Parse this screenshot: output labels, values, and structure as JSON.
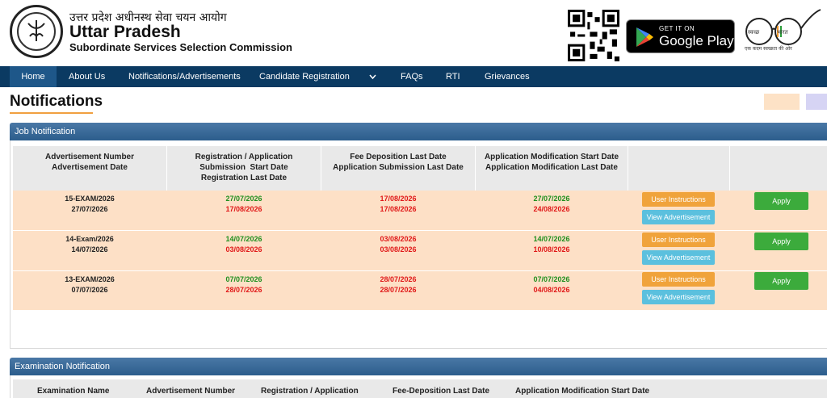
{
  "header": {
    "org_hindi": "उत्तर प्रदेश अधीनस्थ सेवा चयन आयोग",
    "org_title": "Uttar Pradesh",
    "org_subtitle": "Subordinate Services Selection Commission",
    "play_small": "GET IT ON",
    "play_big": "Google Play",
    "swachh_left": "स्वच्छ",
    "swachh_right": "भारत",
    "swachh_tagline": "एक कदम स्वच्छता की ओर"
  },
  "nav": {
    "items": [
      "Home",
      "About Us",
      "Notifications/Advertisements",
      "Candidate Registration",
      "FAQs",
      "RTI",
      "Grievances"
    ],
    "active": "Home",
    "chevron": "chevron-down-icon"
  },
  "page": {
    "title": "Notifications"
  },
  "job_panel": {
    "heading": "Job Notification",
    "columns": [
      [
        "Advertisement Number",
        "Advertisement Date"
      ],
      [
        "Registration / Application",
        "Submission  Start Date",
        "Registration Last Date"
      ],
      [
        "Fee Deposition Last Date",
        "Application Submission Last Date"
      ],
      [
        "Application Modification Start Date",
        "Application Modification Last Date"
      ]
    ],
    "rows": [
      {
        "adv_no": "15-EXAM/2026",
        "adv_date": "27/07/2026",
        "reg_start": "27/07/2026",
        "reg_last": "17/08/2026",
        "fee_last": "17/08/2026",
        "sub_last": "17/08/2026",
        "mod_start": "27/07/2026",
        "mod_last": "24/08/2026"
      },
      {
        "adv_no": "14-Exam/2026",
        "adv_date": "14/07/2026",
        "reg_start": "14/07/2026",
        "reg_last": "03/08/2026",
        "fee_last": "03/08/2026",
        "sub_last": "03/08/2026",
        "mod_start": "14/07/2026",
        "mod_last": "10/08/2026"
      },
      {
        "adv_no": "13-EXAM/2026",
        "adv_date": "07/07/2026",
        "reg_start": "07/07/2026",
        "reg_last": "28/07/2026",
        "fee_last": "28/07/2026",
        "sub_last": "28/07/2026",
        "mod_start": "07/07/2026",
        "mod_last": "04/08/2026"
      }
    ],
    "buttons": {
      "user_instructions": "User Instructions",
      "view_advertisement": "View Advertisement",
      "apply": "Apply"
    }
  },
  "exam_panel": {
    "heading": "Examination Notification",
    "columns": [
      "Examination Name",
      "Advertisement Number",
      "Registration / Application",
      "Fee-Deposition Last Date",
      "Application Modification Start Date"
    ]
  },
  "colors": {
    "nav_bg": "#0b3a62",
    "row_bg": "#fde0c6",
    "green_date": "#1e8f1e",
    "red_date": "#e01818",
    "apply_btn": "#3cab3c",
    "instructions_btn": "#f0a33b",
    "view_btn": "#5bc0de"
  }
}
